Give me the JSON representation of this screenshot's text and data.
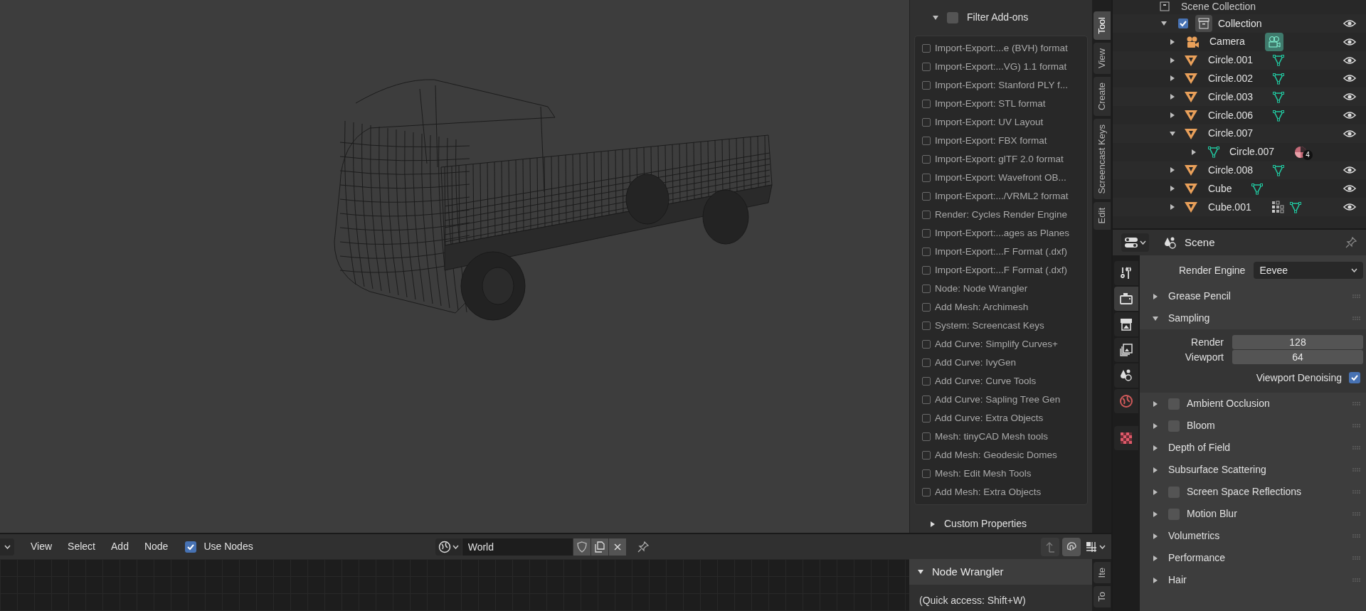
{
  "viewport": {
    "addon_panel": {
      "filter": {
        "label": "Filter Add-ons",
        "checked": false,
        "expanded": true
      },
      "addons": [
        {
          "label": "Import-Export:...e (BVH) format",
          "checked": false
        },
        {
          "label": "Import-Export:...VG) 1.1 format",
          "checked": false
        },
        {
          "label": "Import-Export: Stanford PLY f...",
          "checked": false
        },
        {
          "label": "Import-Export: STL format",
          "checked": false
        },
        {
          "label": "Import-Export: UV Layout",
          "checked": false
        },
        {
          "label": "Import-Export: FBX format",
          "checked": false
        },
        {
          "label": "Import-Export: glTF 2.0 format",
          "checked": false
        },
        {
          "label": "Import-Export: Wavefront OB...",
          "checked": false
        },
        {
          "label": "Import-Export:.../VRML2 format",
          "checked": false
        },
        {
          "label": "Render: Cycles Render Engine",
          "checked": false
        },
        {
          "label": "Import-Export:...ages as Planes",
          "checked": false
        },
        {
          "label": "Import-Export:...F Format (.dxf)",
          "checked": false
        },
        {
          "label": "Import-Export:...F Format (.dxf)",
          "checked": false
        },
        {
          "label": "Node: Node Wrangler",
          "checked": false
        },
        {
          "label": "Add Mesh: Archimesh",
          "checked": false
        },
        {
          "label": "System: Screencast Keys",
          "checked": false
        },
        {
          "label": "Add Curve: Simplify Curves+",
          "checked": false
        },
        {
          "label": "Add Curve: IvyGen",
          "checked": false
        },
        {
          "label": "Add Curve: Curve Tools",
          "checked": false
        },
        {
          "label": "Add Curve: Sapling Tree Gen",
          "checked": false
        },
        {
          "label": "Add Curve: Extra Objects",
          "checked": false
        },
        {
          "label": "Mesh: tinyCAD Mesh tools",
          "checked": false
        },
        {
          "label": "Add Mesh: Geodesic Domes",
          "checked": false
        },
        {
          "label": "Mesh: Edit Mesh Tools",
          "checked": false
        },
        {
          "label": "Add Mesh: Extra Objects",
          "checked": false
        }
      ],
      "custom_properties": {
        "label": "Custom Properties",
        "expanded": false
      }
    },
    "sidebar_tabs": [
      {
        "label": "Tool",
        "selected": true
      },
      {
        "label": "View",
        "selected": false
      },
      {
        "label": "Create",
        "selected": false
      },
      {
        "label": "Screencast Keys",
        "selected": false
      },
      {
        "label": "Edit",
        "selected": false
      }
    ]
  },
  "outliner": {
    "root": "Scene Collection",
    "collection": {
      "name": "Collection",
      "checked": true,
      "expanded": true,
      "visible": true,
      "children": [
        {
          "name": "Camera",
          "kind": "camera",
          "expanded": false,
          "visible": true,
          "extras": [
            {
              "kind": "camera-data"
            }
          ]
        },
        {
          "name": "Circle.001",
          "kind": "mesh",
          "expanded": false,
          "visible": true,
          "extras": [
            {
              "kind": "mesh-data"
            }
          ]
        },
        {
          "name": "Circle.002",
          "kind": "mesh",
          "expanded": false,
          "visible": true,
          "extras": [
            {
              "kind": "mesh-data"
            }
          ]
        },
        {
          "name": "Circle.003",
          "kind": "mesh",
          "expanded": false,
          "visible": true,
          "extras": [
            {
              "kind": "mesh-data"
            }
          ]
        },
        {
          "name": "Circle.006",
          "kind": "mesh",
          "expanded": false,
          "visible": true,
          "extras": [
            {
              "kind": "mesh-data"
            }
          ]
        },
        {
          "name": "Circle.007",
          "kind": "mesh",
          "expanded": true,
          "visible": true,
          "children": [
            {
              "name": "Circle.007",
              "kind": "mesh-data",
              "expanded": false,
              "extras": [
                {
                  "kind": "material"
                }
              ],
              "badge": "4"
            }
          ]
        },
        {
          "name": "Circle.008",
          "kind": "mesh",
          "expanded": false,
          "visible": true,
          "extras": [
            {
              "kind": "mesh-data"
            }
          ]
        },
        {
          "name": "Cube",
          "kind": "mesh",
          "expanded": false,
          "visible": true,
          "extras": [
            {
              "kind": "mesh-data"
            }
          ]
        },
        {
          "name": "Cube.001",
          "kind": "mesh",
          "expanded": false,
          "visible": true,
          "extras": [
            {
              "kind": "modifier"
            },
            {
              "kind": "mesh-data"
            }
          ]
        }
      ]
    }
  },
  "properties": {
    "title": "Scene",
    "tabs": [
      {
        "kind": "tool",
        "selected": false
      },
      {
        "kind": "render",
        "selected": true
      },
      {
        "kind": "output",
        "selected": false
      },
      {
        "kind": "view-layer",
        "selected": false
      },
      {
        "kind": "scene",
        "selected": false
      },
      {
        "kind": "world",
        "selected": false
      },
      {
        "kind": "texture",
        "selected": false
      }
    ],
    "render_engine": {
      "label": "Render Engine",
      "value": "Eevee"
    },
    "panels": [
      {
        "label": "Grease Pencil",
        "expanded": false
      },
      {
        "label": "Sampling",
        "expanded": true,
        "fields": [
          {
            "label": "Render",
            "value": "128"
          },
          {
            "label": "Viewport",
            "value": "64"
          }
        ],
        "toggle": {
          "label": "Viewport Denoising",
          "checked": true
        }
      },
      {
        "label": "Ambient Occlusion",
        "expanded": false,
        "checked": false
      },
      {
        "label": "Bloom",
        "expanded": false,
        "checked": false
      },
      {
        "label": "Depth of Field",
        "expanded": false
      },
      {
        "label": "Subsurface Scattering",
        "expanded": false
      },
      {
        "label": "Screen Space Reflections",
        "expanded": false,
        "checked": false
      },
      {
        "label": "Motion Blur",
        "expanded": false,
        "checked": false
      },
      {
        "label": "Volumetrics",
        "expanded": false
      },
      {
        "label": "Performance",
        "expanded": false
      },
      {
        "label": "Hair",
        "expanded": false
      }
    ]
  },
  "node_editor": {
    "menus": [
      "View",
      "Select",
      "Add",
      "Node"
    ],
    "use_nodes": {
      "label": "Use Nodes",
      "checked": true
    },
    "world": {
      "value": "World"
    },
    "panel": {
      "title": "Node Wrangler",
      "expanded": true,
      "text": "(Quick access: Shift+W)"
    },
    "sidebar_tabs": [
      {
        "label": "Ite",
        "selected": false
      },
      {
        "label": "To",
        "selected": false
      }
    ]
  }
}
